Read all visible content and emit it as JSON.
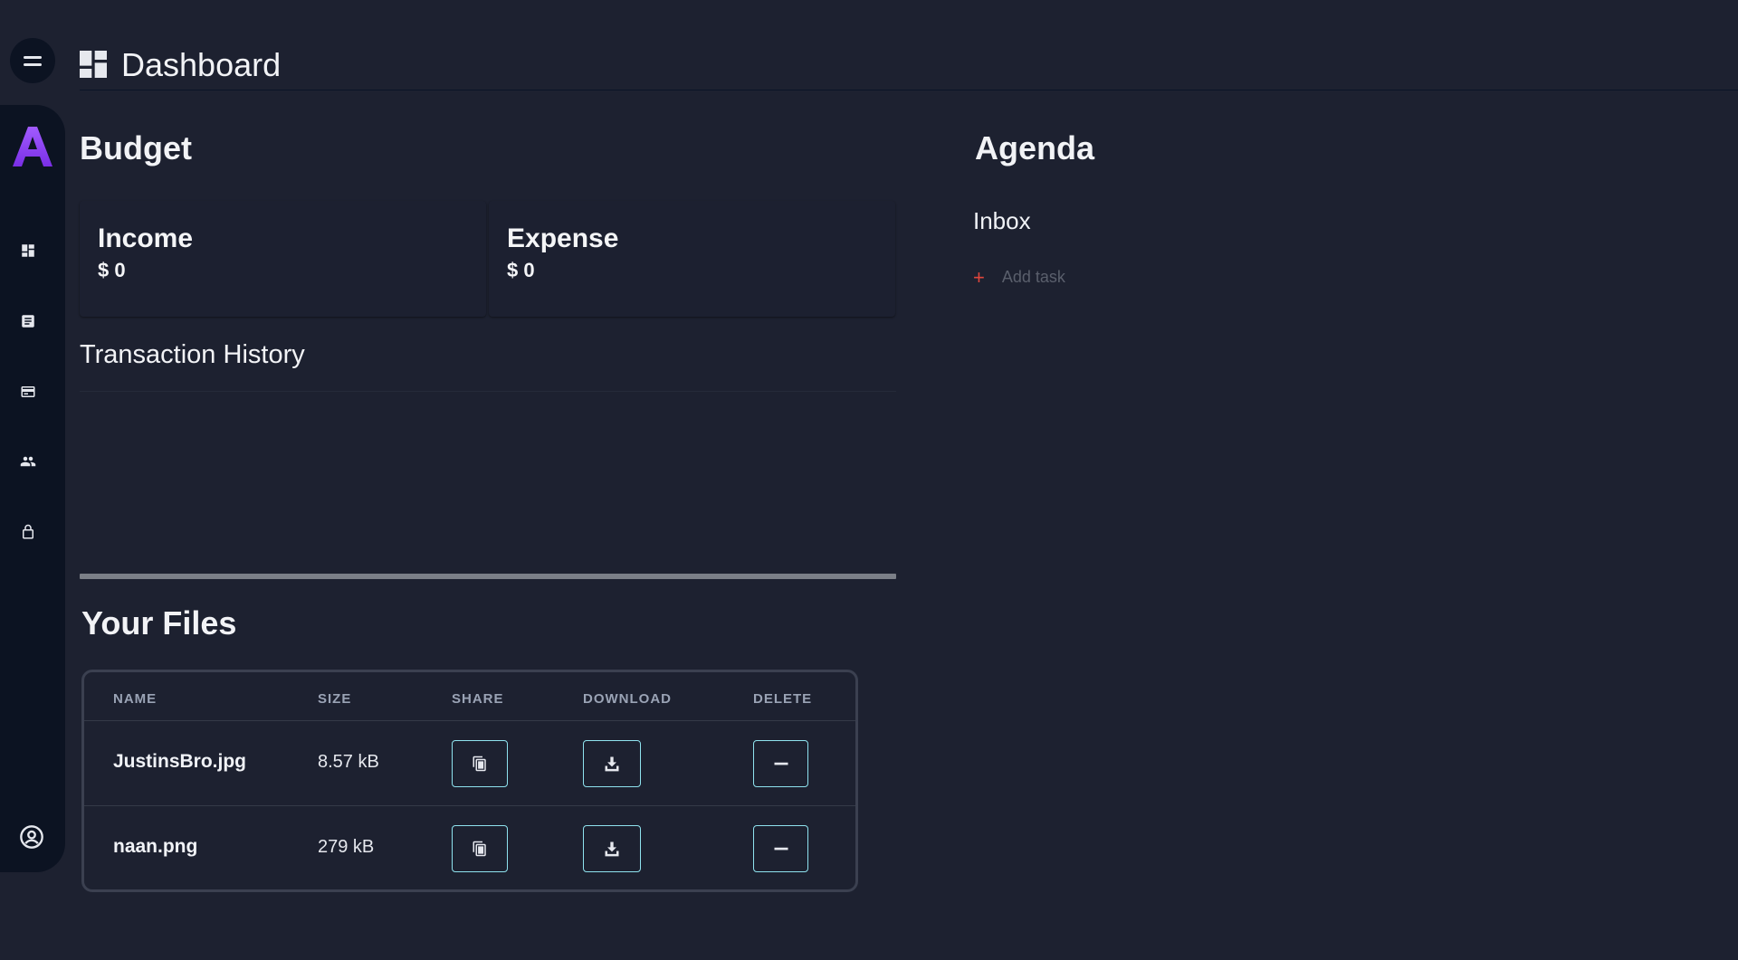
{
  "app": {
    "colors": {
      "background": "#1d2130",
      "sidebar": "#0c1322",
      "accent": "#8fe3ef",
      "logo": "#8a3ff0",
      "add_task_plus": "#e0463c"
    }
  },
  "sidebar": {
    "items": [
      {
        "icon": "dashboard-icon"
      },
      {
        "icon": "notes-icon"
      },
      {
        "icon": "budget-card-icon"
      },
      {
        "icon": "people-icon"
      },
      {
        "icon": "lock-icon"
      }
    ],
    "footer_icon": "account-circle-icon"
  },
  "header": {
    "title": "Dashboard",
    "icon": "dashboard-icon"
  },
  "budget": {
    "title": "Budget",
    "income": {
      "label": "Income",
      "value": "$ 0"
    },
    "expense": {
      "label": "Expense",
      "value": "$ 0"
    },
    "transaction_history_title": "Transaction History"
  },
  "files": {
    "title": "Your Files",
    "columns": [
      "NAME",
      "SIZE",
      "SHARE",
      "DOWNLOAD",
      "DELETE"
    ],
    "rows": [
      {
        "name": "JustinsBro.jpg",
        "size": "8.57 kB"
      },
      {
        "name": "naan.png",
        "size": "279 kB"
      }
    ]
  },
  "agenda": {
    "title": "Agenda",
    "inbox_label": "Inbox",
    "add_task_icon": "+",
    "add_task_label": "Add task"
  }
}
